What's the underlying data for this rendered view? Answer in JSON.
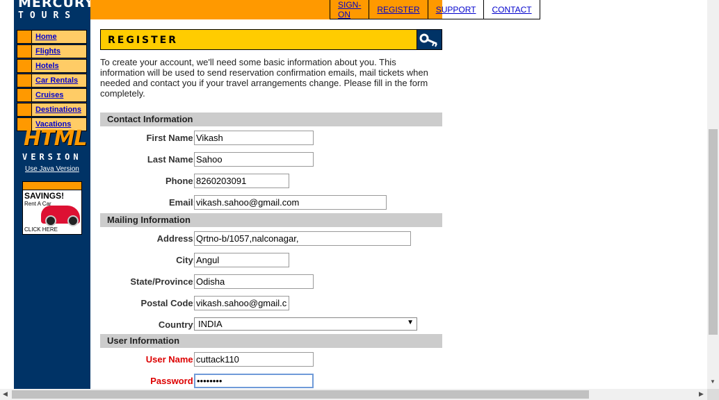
{
  "brand": {
    "line1": "MERCURY",
    "line2": "TOURS"
  },
  "top_menu": [
    "SIGN-ON",
    "REGISTER",
    "SUPPORT",
    "CONTACT"
  ],
  "side_nav": [
    "Home",
    "Flights",
    "Hotels",
    "Car Rentals",
    "Cruises",
    "Destinations",
    "Vacations"
  ],
  "html_badge": {
    "title": "HTML",
    "subtitle": "VERSION",
    "link": "Use Java Version"
  },
  "ad": {
    "title": "SAVINGS!",
    "subtitle": "Rent A Car",
    "cta": "CLICK HERE"
  },
  "register": {
    "title": "REGISTER",
    "intro": "To create your account, we'll need some basic information about you. This information will be used to send reservation confirmation emails, mail tickets when needed and contact you if your travel arrangements change. Please fill in the form completely."
  },
  "sections": {
    "contact": "Contact Information",
    "mailing": "Mailing Information",
    "user": "User Information"
  },
  "fields": {
    "first_name": {
      "label": "First Name:",
      "value": "Vikash"
    },
    "last_name": {
      "label": "Last Name:",
      "value": "Sahoo"
    },
    "phone": {
      "label": "Phone:",
      "value": "8260203091"
    },
    "email": {
      "label": "Email:",
      "value": "vikash.sahoo@gmail.com"
    },
    "address": {
      "label": "Address:",
      "value": "Qrtno-b/1057,nalconagar,"
    },
    "city": {
      "label": "City:",
      "value": "Angul"
    },
    "state": {
      "label": "State/Province:",
      "value": "Odisha"
    },
    "postal": {
      "label": "Postal Code:",
      "value": "vikash.sahoo@gmail.c"
    },
    "country": {
      "label": "Country:",
      "value": "INDIA"
    },
    "username": {
      "label": "User Name:",
      "value": "cuttack110"
    },
    "password": {
      "label": "Password:",
      "value": "••••••••"
    }
  },
  "colors": {
    "sidebar": "#003366",
    "orange": "#ff9900",
    "yellow": "#ffcc00",
    "required": "#dd0000"
  }
}
